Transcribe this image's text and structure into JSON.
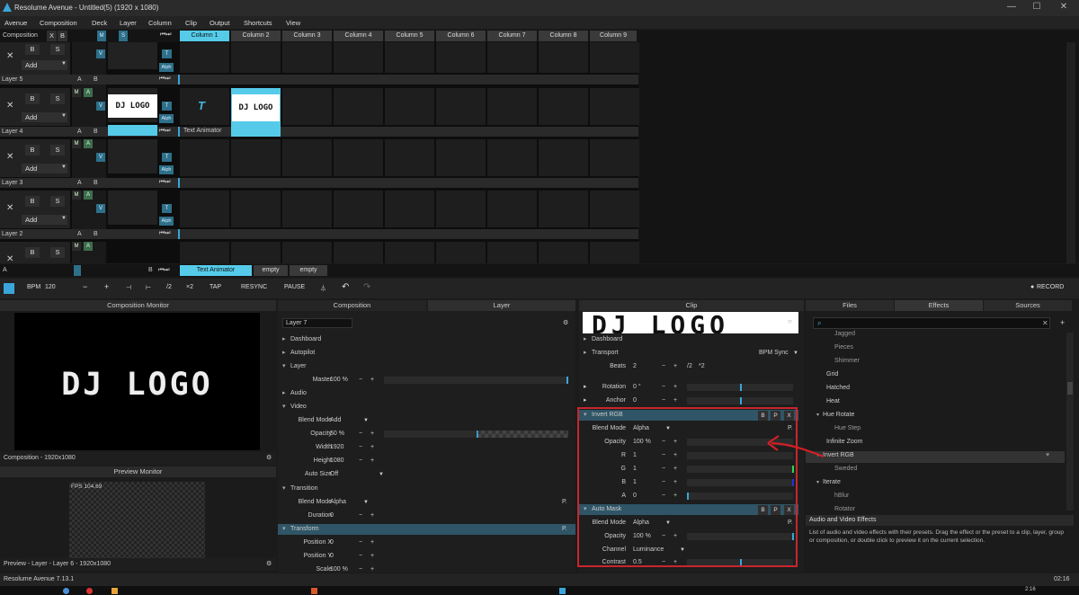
{
  "window": {
    "title": "Resolume Avenue - Untitled(5) (1920 x 1080)"
  },
  "menu": [
    "Avenue",
    "Composition",
    "Deck",
    "Layer",
    "Column",
    "Clip",
    "Output",
    "Shortcuts",
    "View"
  ],
  "comp_header": {
    "label": "Composition",
    "x": "X",
    "b": "B",
    "m": "M",
    "s": "S"
  },
  "columns": [
    "Column 1",
    "Column 2",
    "Column 3",
    "Column 4",
    "Column 5",
    "Column 6",
    "Column 7",
    "Column 8",
    "Column 9"
  ],
  "layer_common": {
    "b": "B",
    "s": "S",
    "add": "Add",
    "a": "A",
    "bb": "B",
    "v": "V",
    "t": "T",
    "alph": "Alph",
    "m": "M"
  },
  "layers": [
    "Layer 5",
    "Layer 4",
    "Layer 3",
    "Layer 2"
  ],
  "clips": {
    "logo_thumb": "DJ LOGO",
    "text_animator": "Text Animator",
    "logo_clip": "DJ LOGO"
  },
  "deck": {
    "a": "A",
    "b": "B",
    "tabs": [
      "Text Animator",
      "empty",
      "empty"
    ]
  },
  "toolbar": {
    "bpm_label": "BPM",
    "bpm_value": "120",
    "minus": "−",
    "plus": "+",
    "div2": "/2",
    "x2": "×2",
    "tap": "TAP",
    "resync": "RESYNC",
    "pause": "PAUSE",
    "record": "RECORD"
  },
  "comp_monitor": {
    "title": "Composition Monitor",
    "logo": "DJ LOGO",
    "footer": "Composition - 1920x1080"
  },
  "preview_monitor": {
    "title": "Preview Monitor",
    "fps": "FPS 104.69",
    "footer": "Preview - Layer - Layer 6 - 1920x1080"
  },
  "layer_panel": {
    "tabs": [
      "Composition",
      "Layer"
    ],
    "name_field": "Layer 7",
    "sections": {
      "dashboard": "Dashboard",
      "autopilot": "Autopilot",
      "layer": "Layer",
      "audio": "Audio",
      "video": "Video",
      "transition": "Transition",
      "transform": "Transform"
    },
    "master_label": "Master",
    "master_value": "100 %",
    "blend_label": "Blend Mode",
    "blend_value": "Add",
    "opacity_label": "Opacity",
    "opacity_value": "50 %",
    "width_label": "Width",
    "width_value": "1920",
    "height_label": "Height",
    "height_value": "1080",
    "autosize_label": "Auto Size",
    "autosize_value": "Off",
    "t_blend_label": "Blend Mode",
    "t_blend_value": "Alpha",
    "duration_label": "Duration",
    "duration_value": "0",
    "posx_label": "Position X",
    "posx_value": "0",
    "posy_label": "Position Y",
    "posy_value": "0",
    "scale_label": "Scale",
    "scale_value": "100 %"
  },
  "clip_panel": {
    "title": "Clip",
    "logo": "DJ LOGO",
    "dashboard": "Dashboard",
    "transport": "Transport",
    "transport_mode": "BPM Sync",
    "beats_label": "Beats",
    "beats_value": "2",
    "div2": "/2",
    "x2": "*2",
    "scale_label": "Scale",
    "scale_value": "100 %",
    "rotation_label": "Rotation",
    "rotation_value": "0 °",
    "anchor_label": "Anchor",
    "anchor_value": "0",
    "invert_rgb": {
      "title": "Invert RGB",
      "b": "B",
      "p": "P",
      "x": "X",
      "blend_label": "Blend Mode",
      "blend_value": "Alpha",
      "opacity_label": "Opacity",
      "opacity_value": "100 %",
      "r_label": "R",
      "r_value": "1",
      "g_label": "G",
      "g_value": "1",
      "b_label": "B",
      "b_value": "1",
      "a_label": "A",
      "a_value": "0"
    },
    "auto_mask": {
      "title": "Auto Mask",
      "b": "B",
      "p": "P",
      "x": "X",
      "blend_label": "Blend Mode",
      "blend_value": "Alpha",
      "opacity_label": "Opacity",
      "opacity_value": "100 %",
      "channel_label": "Channel",
      "channel_value": "Luminance",
      "contrast_label": "Contrast",
      "contrast_value": "0.5"
    }
  },
  "browser": {
    "tabs": [
      "Files",
      "Effects",
      "Sources"
    ],
    "items": [
      {
        "label": "Jagged",
        "indent": 2
      },
      {
        "label": "Pieces",
        "indent": 2
      },
      {
        "label": "Shimmer",
        "indent": 2
      },
      {
        "label": "Grid",
        "indent": 1
      },
      {
        "label": "Hatched",
        "indent": 1
      },
      {
        "label": "Heat",
        "indent": 1
      },
      {
        "label": "Hue Rotate",
        "indent": 0
      },
      {
        "label": "Hue Step",
        "indent": 2
      },
      {
        "label": "Infinite Zoom",
        "indent": 1
      },
      {
        "label": "Invert RGB",
        "indent": 0
      },
      {
        "label": "Sweded",
        "indent": 2
      },
      {
        "label": "Iterate",
        "indent": 0
      },
      {
        "label": "hBlur",
        "indent": 2
      },
      {
        "label": "Rotator",
        "indent": 2
      }
    ],
    "info_title": "Audio and Video Effects",
    "info_text": "List of audio and video effects with their presets. Drag the effect or the preset to a clip, layer, group or composition, or double click to preview it on the current selection."
  },
  "status": {
    "version": "Resolume Avenue 7.13.1",
    "time": "02:16"
  },
  "taskbar": {
    "time": "2:16"
  }
}
